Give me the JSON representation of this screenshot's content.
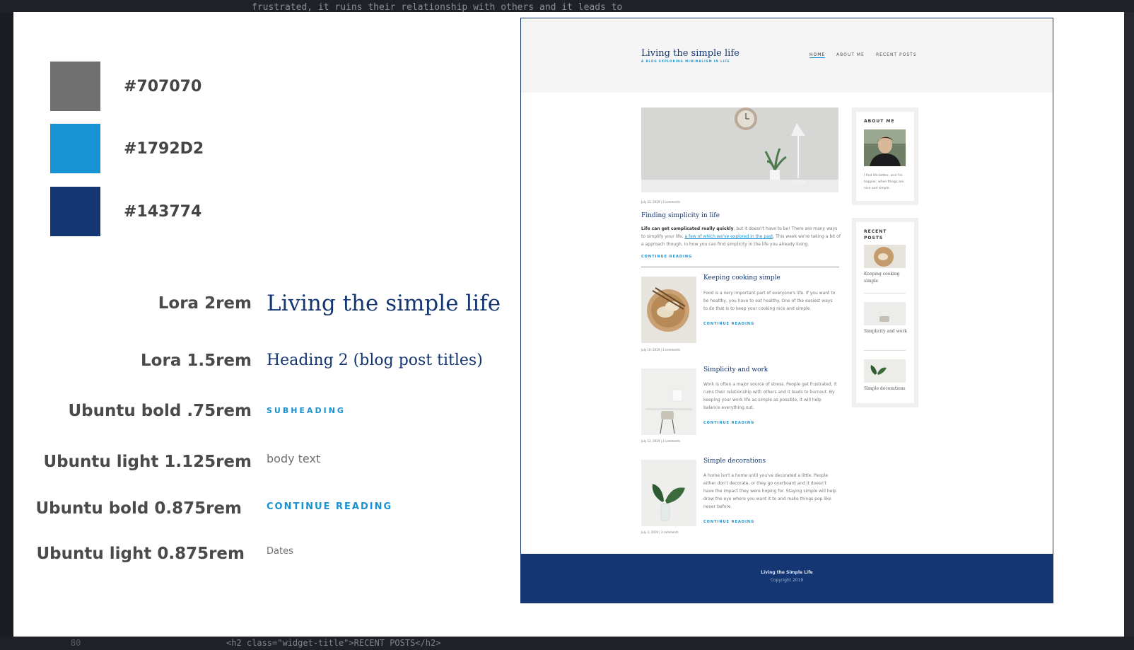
{
  "editor": {
    "top_code": "frustrated, it ruins their relationship with others and it leads to",
    "bottom_line_number": "80",
    "bottom_code": "<h2 class=\"widget-title\">RECENT POSTS</h2>"
  },
  "palette": [
    {
      "hex": "#707070",
      "color": "#707070"
    },
    {
      "hex": "#1792D2",
      "color": "#1792D2"
    },
    {
      "hex": "#143774",
      "color": "#143774"
    }
  ],
  "typography": [
    {
      "font": "Lora 2rem",
      "sample": "Living the simple life"
    },
    {
      "font": "Lora 1.5rem",
      "sample": "Heading 2 (blog post titles)"
    },
    {
      "font": "Ubuntu bold .75rem",
      "sample": "SUBHEADING"
    },
    {
      "font": "Ubuntu light 1.125rem",
      "sample": "body text"
    },
    {
      "font": "Ubuntu bold 0.875rem",
      "sample": "CONTINUE READING"
    },
    {
      "font": "Ubuntu light 0.875rem",
      "sample": "Dates"
    }
  ],
  "mockup": {
    "site_title": "Living the simple life",
    "site_subtitle": "A BLOG EXPLORING MINIMALISM IN LIFE",
    "nav": [
      "HOME",
      "ABOUT ME",
      "RECENT POSTS"
    ],
    "featured": {
      "meta": "July 23, 2019  |  3 comments",
      "title": "Finding simplicity in life",
      "text_bold": "Life can get complicated really quickly",
      "text_1": ", but it doesn't have to be! There are many ways to simplify your life, ",
      "text_link": "a few of which we've explored in the past",
      "text_2": ". This week we're taking a bit of a approach though, in how you can find simplicity in the life you already living.",
      "continue": "CONTINUE READING"
    },
    "posts": [
      {
        "title": "Keeping cooking simple",
        "text": "Food is a very important part of everyone's life. If you want to be healthy, you have to eat healthy. One of the easiest ways to do that is to keep your cooking nice and simple.",
        "continue": "CONTINUE READING",
        "meta": "July 19, 2019  |  3 comments"
      },
      {
        "title": "Simplicity and work",
        "text": "Work is often a major source of stress. People get frustrated, it ruins their relationship with others and it leads to burnout. By keeping your work life as simple as possible, it will help balance everything out.",
        "continue": "CONTINUE READING",
        "meta": "July 12, 2019  |  3 comments"
      },
      {
        "title": "Simple decorations",
        "text": "A home isn't a home until you've decorated a little. People either don't decorate, or they go overboard and it doesn't have the impact they were hoping for. Staying simple will help draw the eye where you want it to and make things pop like never before.",
        "continue": "CONTINUE READING",
        "meta": "July 3, 2019  |  3 comments"
      }
    ],
    "about": {
      "title": "ABOUT ME",
      "text": "I find life better, and I'm happier, when things are nice and simple."
    },
    "recent": {
      "title": "RECENT POSTS",
      "items": [
        "Keeping cooking simple",
        "Simplicity and work",
        "Simple decorations"
      ]
    },
    "footer": {
      "title": "Living the Simple Life",
      "copyright": "Copyright 2019"
    }
  }
}
